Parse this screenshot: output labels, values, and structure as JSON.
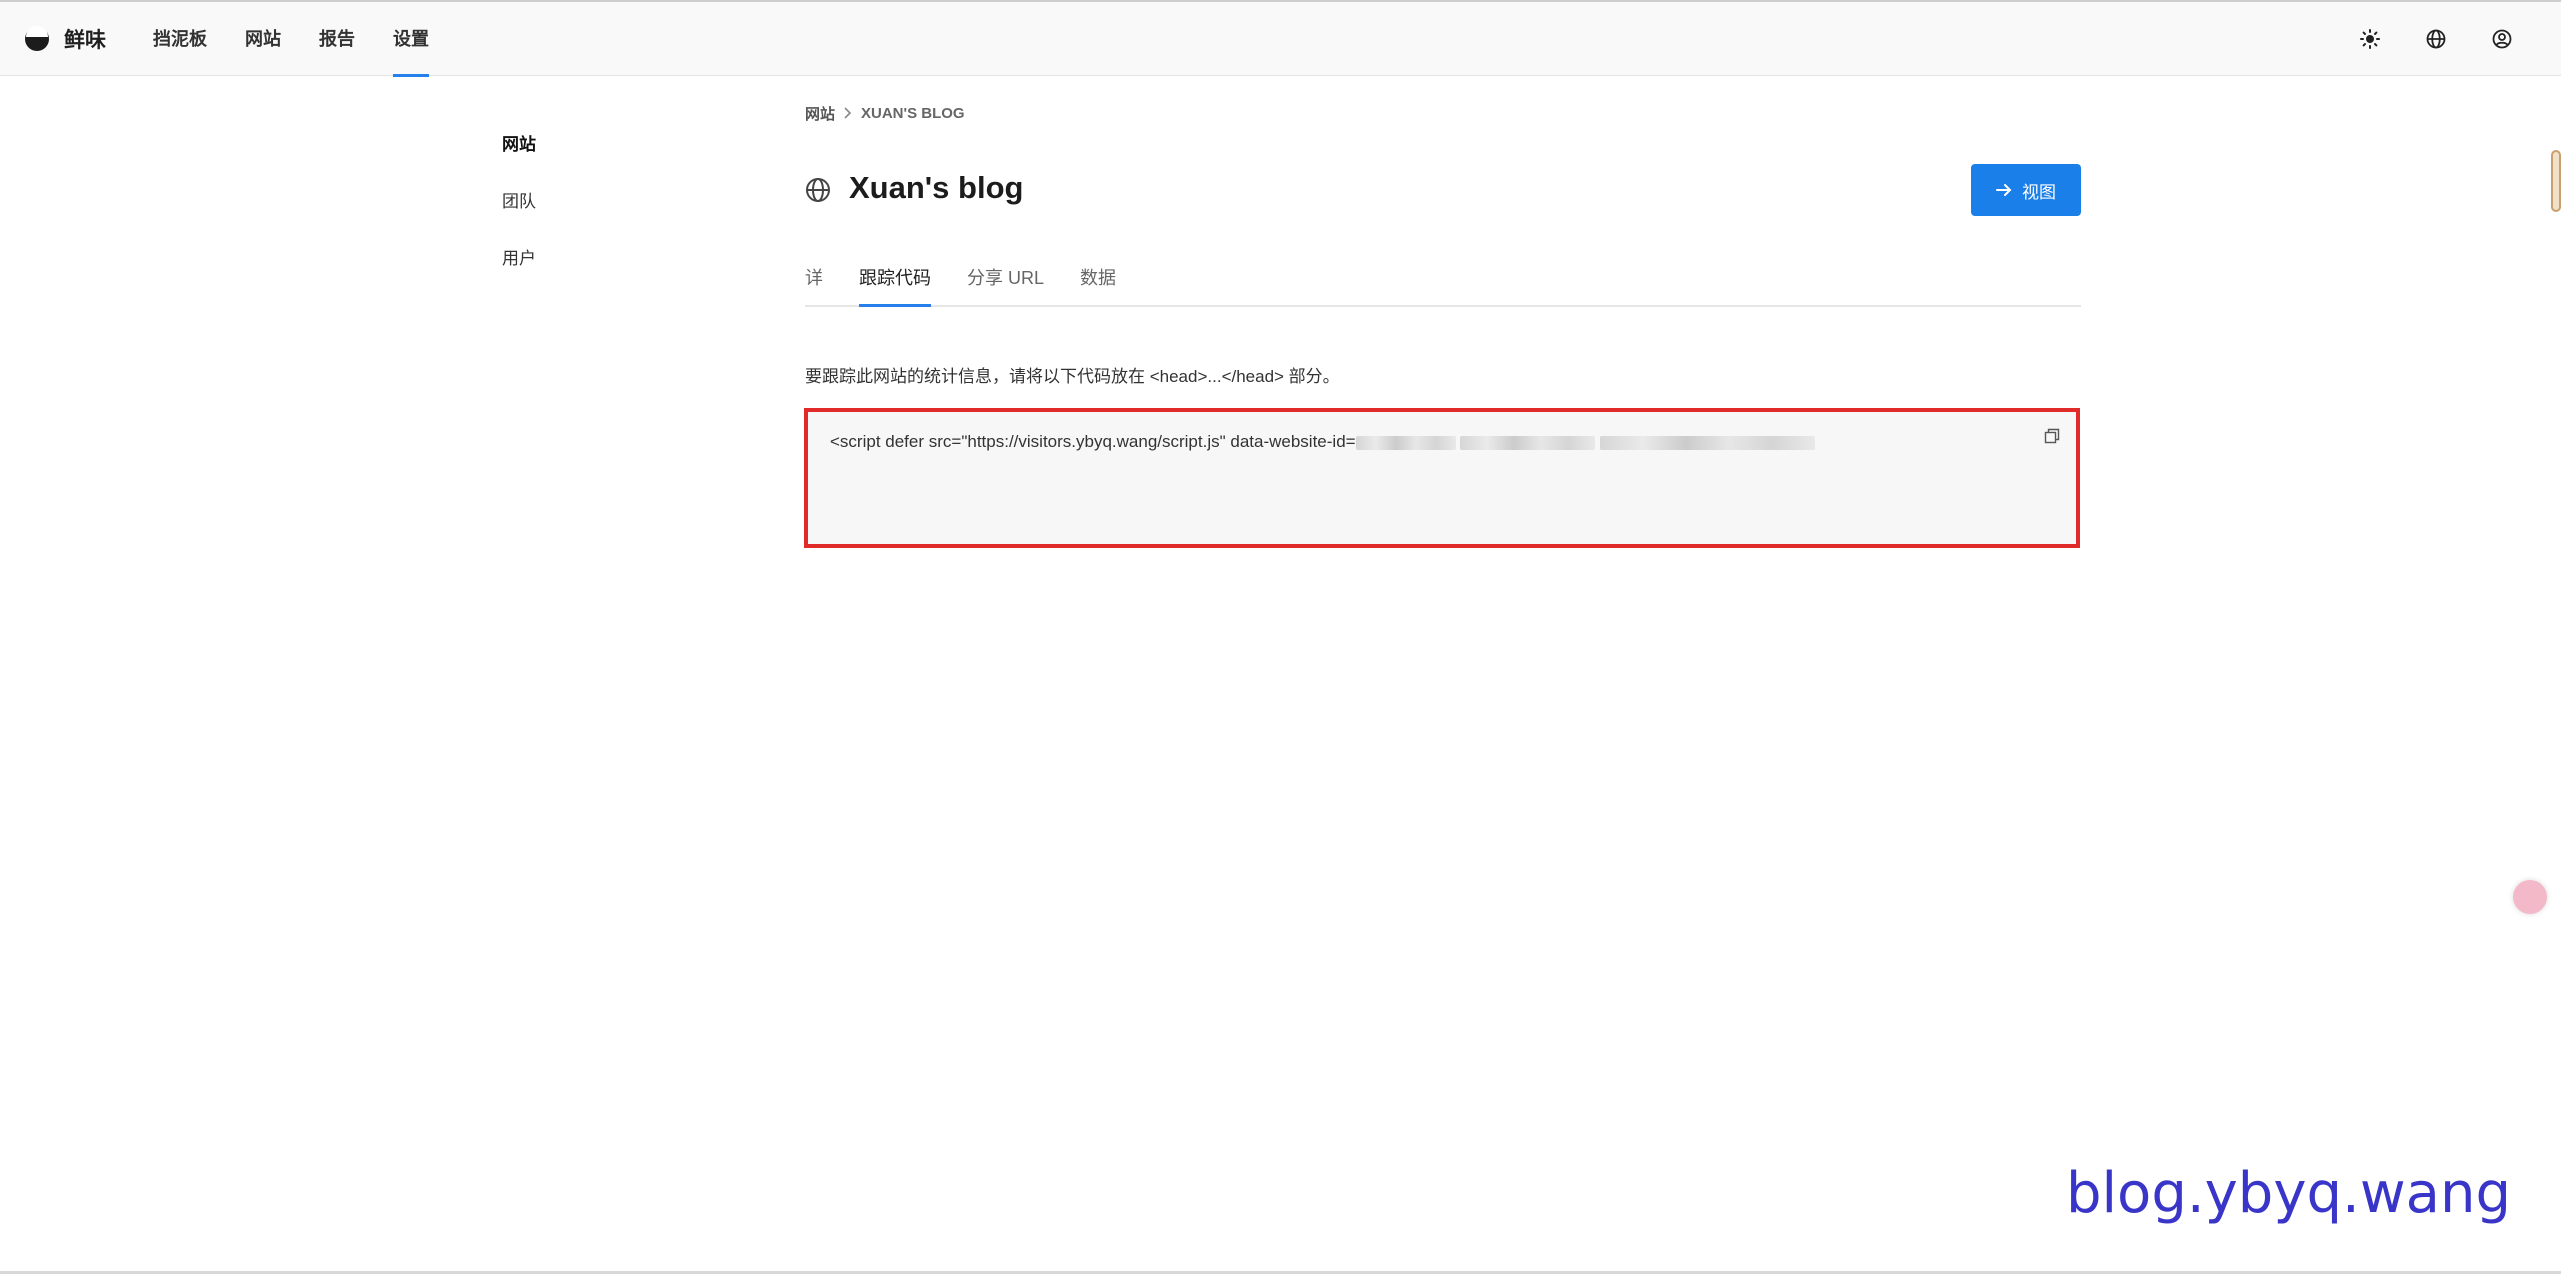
{
  "app": {
    "name": "鲜味"
  },
  "nav": {
    "items": [
      "挡泥板",
      "网站",
      "报告",
      "设置"
    ],
    "active": "设置"
  },
  "top_icons": [
    "sun-icon",
    "globe-icon",
    "user-circle-icon"
  ],
  "sidebar": {
    "items": [
      {
        "label": "网站",
        "active": true
      },
      {
        "label": "团队"
      },
      {
        "label": "用户"
      }
    ]
  },
  "breadcrumb": {
    "parent": "网站",
    "current": "XUAN'S BLOG"
  },
  "page": {
    "title": "Xuan's blog",
    "view_button": "视图"
  },
  "tabs": [
    {
      "label": "详"
    },
    {
      "label": "跟踪代码",
      "active": true
    },
    {
      "label": "分享 URL"
    },
    {
      "label": "数据"
    }
  ],
  "tracking": {
    "description": "要跟踪此网站的统计信息，请将以下代码放在 <head>...</head> 部分。",
    "code_prefix": "<script defer src=\"https://visitors.ybyq.wang/script.js\" data-website-id="
  },
  "watermark": "blog.ybyq.wang",
  "colors": {
    "accent": "#2680eb",
    "button": "#1a7fe8",
    "highlight_border": "#e12a2a",
    "watermark": "#3a35c9"
  }
}
